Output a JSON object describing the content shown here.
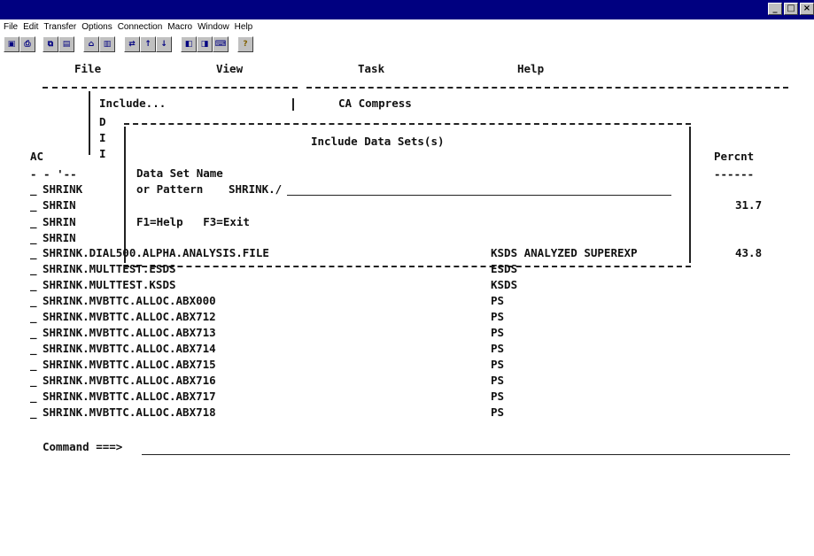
{
  "window": {
    "buttons": [
      "_",
      "□",
      "×"
    ]
  },
  "menubar": {
    "items": [
      "File",
      "Edit",
      "Transfer",
      "Options",
      "Connection",
      "Macro",
      "Window",
      "Help"
    ]
  },
  "toolbar": {
    "icons": [
      "screen-icon",
      "print-icon",
      "copy-icon",
      "paste-icon",
      "open-icon",
      "save-icon",
      "send-icon",
      "send-file-icon",
      "receive-file-icon",
      "macro-icon",
      "record-icon",
      "keyboard-icon",
      "help-icon"
    ]
  },
  "screen_menu": {
    "items": [
      "File",
      "View",
      "Task",
      "Help"
    ]
  },
  "dropdown": {
    "item1": "Include...",
    "item2": "CA Compress",
    "letters": [
      "D",
      "I",
      "I"
    ]
  },
  "dialog": {
    "title": "Include Data Sets(s)",
    "label1": "Data Set Name",
    "label2": "or Pattern",
    "field_value": "SHRINK./",
    "keys": "F1=Help   F3=Exit"
  },
  "table": {
    "ac_header": "AC",
    "percent_header": "Percnt",
    "header_sep": "- - '--",
    "percent_sep": "------",
    "partial_rows": [
      {
        "name": "SHRINK",
        "percent": ""
      },
      {
        "name": "SHRIN",
        "percent": "31.7"
      },
      {
        "name": "SHRIN",
        "percent": ""
      },
      {
        "name": "SHRIN",
        "percent": ""
      }
    ],
    "rows": [
      {
        "name": "SHRINK.DIAL500.ALPHA.ANALYSIS.FILE",
        "type": "KSDS ANALYZED SUPEREXP",
        "percent": "43.8"
      },
      {
        "name": "SHRINK.MULTTEST.ESDS",
        "type": "ESDS",
        "percent": ""
      },
      {
        "name": "SHRINK.MULTTEST.KSDS",
        "type": "KSDS",
        "percent": ""
      },
      {
        "name": "SHRINK.MVBTTC.ALLOC.ABX000",
        "type": "PS",
        "percent": ""
      },
      {
        "name": "SHRINK.MVBTTC.ALLOC.ABX712",
        "type": "PS",
        "percent": ""
      },
      {
        "name": "SHRINK.MVBTTC.ALLOC.ABX713",
        "type": "PS",
        "percent": ""
      },
      {
        "name": "SHRINK.MVBTTC.ALLOC.ABX714",
        "type": "PS",
        "percent": ""
      },
      {
        "name": "SHRINK.MVBTTC.ALLOC.ABX715",
        "type": "PS",
        "percent": ""
      },
      {
        "name": "SHRINK.MVBTTC.ALLOC.ABX716",
        "type": "PS",
        "percent": ""
      },
      {
        "name": "SHRINK.MVBTTC.ALLOC.ABX717",
        "type": "PS",
        "percent": ""
      },
      {
        "name": "SHRINK.MVBTTC.ALLOC.ABX718",
        "type": "PS",
        "percent": ""
      }
    ]
  },
  "command": {
    "label": "Command ===>"
  }
}
